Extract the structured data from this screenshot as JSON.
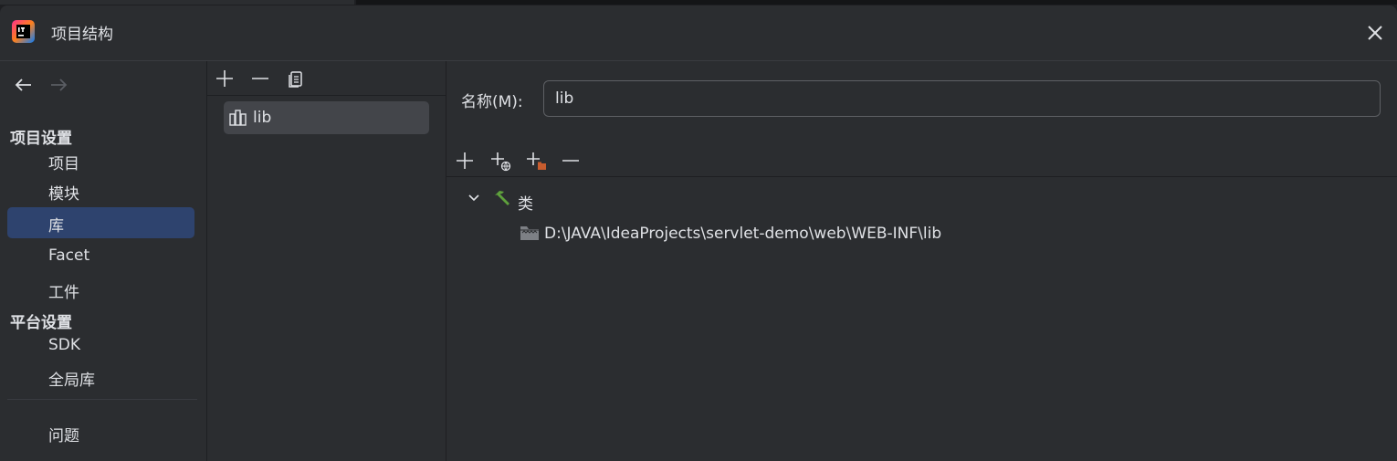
{
  "window": {
    "title": "项目结构"
  },
  "icons": {
    "app": "intellij-logo-icon",
    "close": "close-icon",
    "back": "arrow-left-icon",
    "forward": "arrow-right-icon",
    "add": "plus-icon",
    "remove": "minus-icon",
    "copy": "copy-icon",
    "library": "library-icon",
    "add_url": "add-url-icon",
    "add_folder": "add-folder-icon",
    "expand": "chevron-down-icon",
    "classes": "hammer-icon",
    "jar_folder": "jar-folder-icon"
  },
  "colors": {
    "background": "#2b2d30",
    "selection": "#2e436e",
    "list_selection": "#43454a",
    "accent_green": "#5fa13c",
    "accent_orange": "#c75c2e"
  },
  "sidebar": {
    "project_settings_header": "项目设置",
    "project_settings_items": [
      {
        "label": "项目",
        "selected": false
      },
      {
        "label": "模块",
        "selected": false
      },
      {
        "label": "库",
        "selected": true
      },
      {
        "label": "Facet",
        "selected": false
      },
      {
        "label": "工件",
        "selected": false
      }
    ],
    "platform_settings_header": "平台设置",
    "platform_settings_items": [
      {
        "label": "SDK",
        "selected": false
      },
      {
        "label": "全局库",
        "selected": false
      }
    ],
    "problems": {
      "label": "问题"
    }
  },
  "library_list": {
    "items": [
      {
        "label": "lib",
        "selected": true
      }
    ]
  },
  "detail": {
    "name_label": "名称(M):",
    "name_value": "lib",
    "tree": {
      "classes_label": "类",
      "expanded": true,
      "entries": [
        "D:\\JAVA\\IdeaProjects\\servlet-demo\\web\\WEB-INF\\lib"
      ]
    }
  }
}
